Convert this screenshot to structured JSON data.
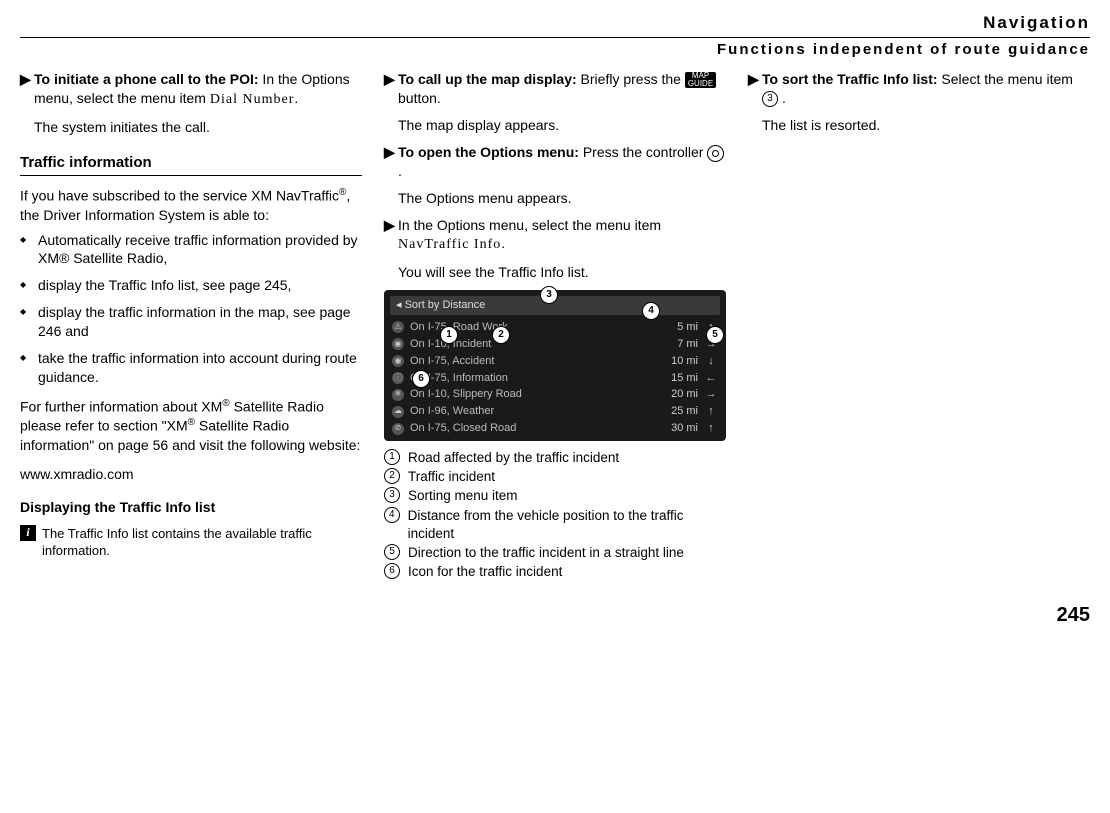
{
  "page": {
    "title": "Navigation",
    "subtitle": "Functions independent of route guidance",
    "number": "245"
  },
  "col1": {
    "step_call_poi_bold": "To initiate a phone call to the POI:",
    "step_call_poi_rest": " In the Options menu, select the menu item ",
    "step_call_poi_menuitem": "Dial Number",
    "step_call_poi_follow": "The system initiates the call.",
    "traffic_head": "Traffic information",
    "traffic_intro_a": "If you have subscribed to the service XM NavTraffic",
    "traffic_intro_b": ", the Driver Information System is able to:",
    "bullets": [
      "Automatically receive traffic information provided by XM® Satellite Radio,",
      "display the Traffic Info list, see page 245,",
      "display the traffic information in the map, see page 246 and",
      "take the traffic information into account during route guidance."
    ],
    "further_a": "For further information about XM",
    "further_b": " Satellite Radio please refer to section \"XM",
    "further_c": " Satellite Radio information\" on page 56 and visit the following website:",
    "url": "www.xmradio.com",
    "display_head": "Displaying the Traffic Info list",
    "note": "The Traffic Info list contains the available traffic information."
  },
  "col2": {
    "step_map_bold": "To call up the map display:",
    "step_map_rest": " Briefly press the ",
    "step_map_follow": " button.",
    "map_label_a": "MAP",
    "map_label_b": "GUIDE",
    "map_appears": "The map display appears.",
    "step_opt_bold": "To open the Options menu:",
    "step_opt_rest": " Press the controller ",
    "opt_appears": "The Options menu appears.",
    "step_select_a": "In the Options menu, select the menu item ",
    "step_select_menuitem": "NavTraffic Info",
    "see_list": "You will see the Traffic Info list.",
    "screenshot": {
      "header": "Sort by Distance",
      "rows": [
        {
          "road": "On I-75, Road Work",
          "dist": "5 mi",
          "dir": "↑"
        },
        {
          "road": "On I-10, Incident",
          "dist": "7 mi",
          "dir": "→"
        },
        {
          "road": "On I-75, Accident",
          "dist": "10 mi",
          "dir": "↓"
        },
        {
          "road": "On I-75, Information",
          "dist": "15 mi",
          "dir": "←"
        },
        {
          "road": "On I-10, Slippery Road",
          "dist": "20 mi",
          "dir": "→"
        },
        {
          "road": "On I-96, Weather",
          "dist": "25 mi",
          "dir": "↑"
        },
        {
          "road": "On I-75, Closed Road",
          "dist": "30 mi",
          "dir": "↑"
        }
      ]
    },
    "callouts": [
      {
        "n": "1",
        "text": "Road affected by the traffic incident"
      },
      {
        "n": "2",
        "text": "Traffic incident"
      },
      {
        "n": "3",
        "text": "Sorting menu item"
      },
      {
        "n": "4",
        "text": "Distance from the vehicle position to the traffic incident"
      },
      {
        "n": "5",
        "text": "Direction to the traffic incident in a straight line"
      },
      {
        "n": "6",
        "text": "Icon for the traffic incident"
      }
    ]
  },
  "col3": {
    "step_sort_bold": "To sort the Traffic Info list:",
    "step_sort_rest_a": " Select the menu item ",
    "step_sort_num": "3",
    "resorted": "The list is resorted."
  }
}
